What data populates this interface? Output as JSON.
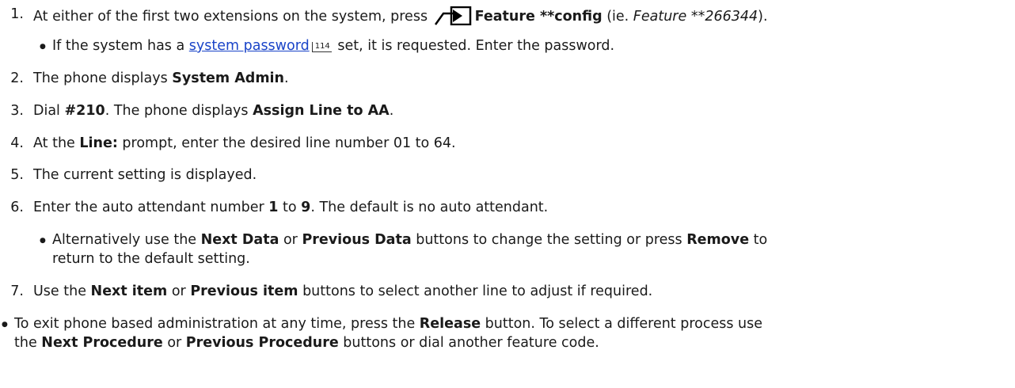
{
  "steps": [
    {
      "num": "1.",
      "pre": "At either of the first two extensions on the system, press ",
      "bold": "Feature **config",
      "mid": " (ie. ",
      "italic": "Feature **266344",
      "post": ")."
    },
    {
      "num": "2.",
      "pre": "The phone displays ",
      "bold": "System Admin",
      "post": "."
    },
    {
      "num": "3.",
      "pre": "Dial ",
      "bold": "#210",
      "mid": ". The phone displays ",
      "bold2": "Assign Line to AA",
      "post": "."
    },
    {
      "num": "4.",
      "pre": "At the ",
      "bold": "Line:",
      "post": " prompt, enter the desired line number 01 to 64."
    },
    {
      "num": "5.",
      "text": "The current setting is displayed."
    },
    {
      "num": "6.",
      "pre": "Enter the auto attendant number ",
      "bold": "1",
      "mid": " to ",
      "bold2": "9",
      "post": ". The default is no auto attendant."
    },
    {
      "num": "7.",
      "pre": "Use the ",
      "bold": "Next item",
      "mid": " or ",
      "bold2": "Previous item",
      "post": " buttons to select another line to adjust if required."
    }
  ],
  "sub1": {
    "pre": "If the system has a ",
    "link": "system password",
    "pageref": "114",
    "post": " set, it is requested. Enter the password."
  },
  "sub6": {
    "line1_pre": "Alternatively use the ",
    "line1_b1": "Next Data",
    "line1_mid": " or ",
    "line1_b2": "Previous Data",
    "line1_mid2": " buttons to change the setting or press ",
    "line1_b3": "Remove",
    "line1_post": " to",
    "line2": "return to the default setting."
  },
  "final": {
    "line1_pre": "To exit phone based administration at any time, press the ",
    "line1_b1": "Release",
    "line1_post": " button. To select a different process use",
    "line2_pre": "the ",
    "line2_b1": "Next Procedure",
    "line2_mid": " or ",
    "line2_b2": "Previous Procedure",
    "line2_post": " buttons or dial another feature code."
  },
  "icons": {
    "feature": "feature-button-icon"
  }
}
